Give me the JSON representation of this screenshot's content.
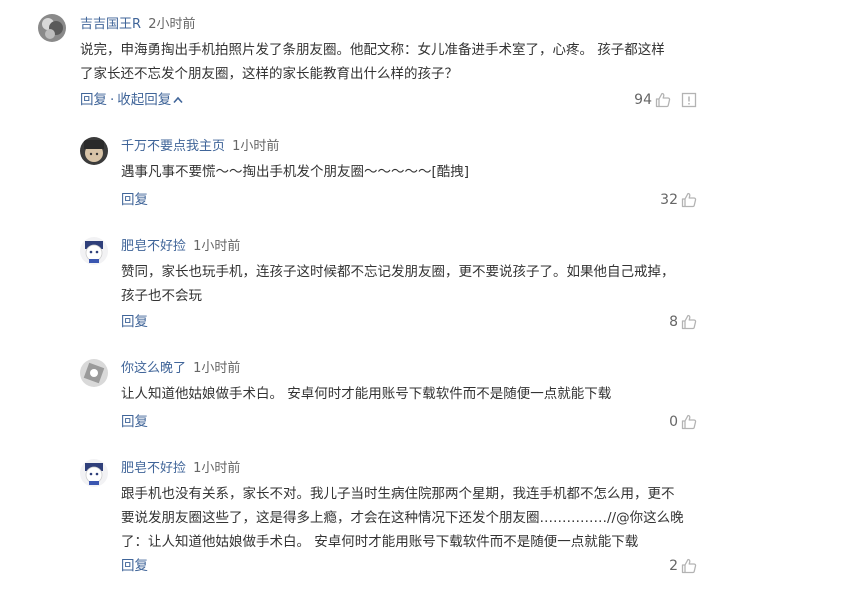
{
  "comments": [
    {
      "user": "吉吉国王R",
      "time": "2小时前",
      "lines": [
        "说完，申海勇掏出手机拍照片发了条朋友圈。他配文称：女儿准备进手术室了，心疼。 孩子都这样",
        "了家长还不忘发个朋友圈，这样的家长能教育出什么样的孩子？"
      ],
      "reply_label": "回复",
      "collapse_label": "收起回复",
      "likes": "94"
    },
    {
      "user": "千万不要点我主页",
      "time": "1小时前",
      "lines": [
        "遇事凡事不要慌～～掏出手机发个朋友圈～～～～～[酷拽]"
      ],
      "reply_label": "回复",
      "likes": "32"
    },
    {
      "user": "肥皂不好捡",
      "time": "1小时前",
      "lines": [
        "赞同，家长也玩手机，连孩子这时候都不忘记发朋友圈，更不要说孩子了。如果他自己戒掉，",
        "孩子也不会玩"
      ],
      "reply_label": "回复",
      "likes": "8"
    },
    {
      "user": "你这么晚了",
      "time": "1小时前",
      "lines": [
        "让人知道他姑娘做手术白。 安卓何时才能用账号下载软件而不是随便一点就能下载"
      ],
      "reply_label": "回复",
      "likes": "0"
    },
    {
      "user": "肥皂不好捡",
      "time": "1小时前",
      "lines": [
        "跟手机也没有关系，家长不对。我儿子当时生病住院那两个星期，我连手机都不怎么用，更不",
        "要说发朋友圈这些了，这是得多上瘾，才会在这种情况下还发个朋友圈……………//@你这么晚",
        "了：让人知道他姑娘做手术白。 安卓何时才能用账号下载软件而不是随便一点就能下载"
      ],
      "reply_label": "回复",
      "likes": "2"
    }
  ],
  "icons": {
    "like": "thumbs-up-icon",
    "report": "report-icon",
    "collapse": "chevron-up-icon"
  },
  "colors": {
    "link": "#406599",
    "text": "#333333",
    "muted": "#666666",
    "icon": "#b3b3b3"
  }
}
